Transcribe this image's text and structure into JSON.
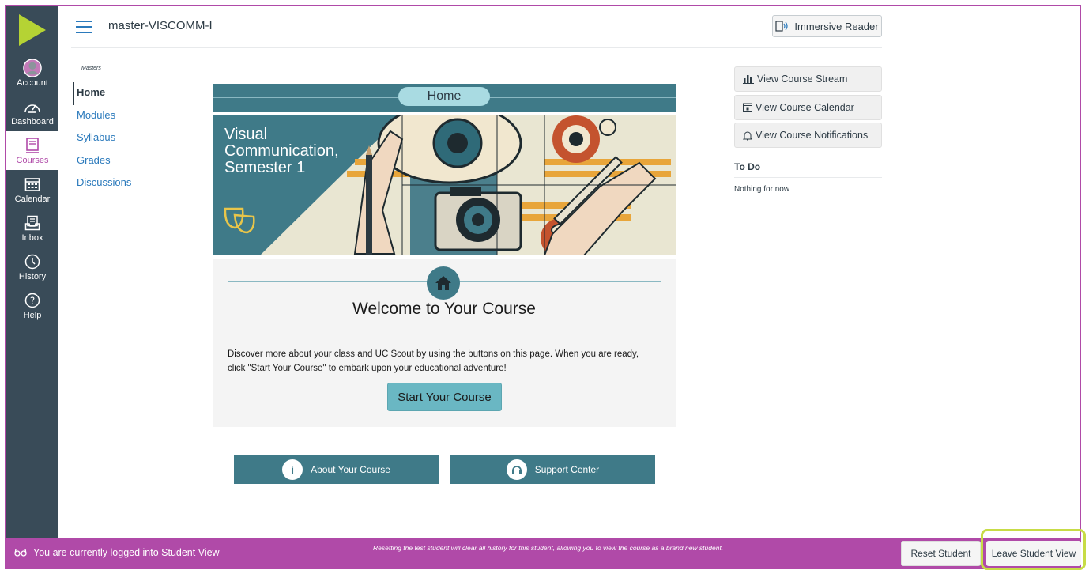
{
  "colors": {
    "nav_bg": "#394b58",
    "accent": "#b04aa8",
    "teal": "#3f7a88",
    "link": "#2b7abc",
    "highlight": "#c7dc46"
  },
  "global_nav": {
    "logo": "canvas-play-icon",
    "items": [
      {
        "label": "Account",
        "icon": "avatar-icon"
      },
      {
        "label": "Dashboard",
        "icon": "dashboard-icon"
      },
      {
        "label": "Courses",
        "icon": "courses-icon",
        "active": true
      },
      {
        "label": "Calendar",
        "icon": "calendar-icon"
      },
      {
        "label": "Inbox",
        "icon": "inbox-icon"
      },
      {
        "label": "History",
        "icon": "clock-icon"
      },
      {
        "label": "Help",
        "icon": "help-icon"
      }
    ]
  },
  "header": {
    "course_title": "master-VISCOMM-I",
    "immersive_reader": "Immersive Reader"
  },
  "course_nav": {
    "tag": "Masters",
    "items": [
      {
        "label": "Home",
        "active": true
      },
      {
        "label": "Modules"
      },
      {
        "label": "Syllabus"
      },
      {
        "label": "Grades"
      },
      {
        "label": "Discussions"
      }
    ]
  },
  "main": {
    "home_label": "Home",
    "banner": {
      "line1": "Visual",
      "line2": "Communication,",
      "line3": "Semester 1"
    },
    "welcome_title": "Welcome to Your Course",
    "welcome_desc": "Discover more about your class and UC Scout by using the buttons on this page. When you are ready, click \"Start Your Course\" to embark upon your educational adventure!",
    "start_button": "Start Your Course",
    "about_button": "About Your Course",
    "support_button": "Support Center"
  },
  "sidebar": {
    "stream": "View Course Stream",
    "calendar": "View Course Calendar",
    "notifications": "View Course Notifications",
    "todo_title": "To Do",
    "todo_empty": "Nothing for now"
  },
  "student_view": {
    "label": "You are currently logged into Student View",
    "note": "Resetting the test student will clear all history for this student, allowing you to view the course as a brand new student.",
    "reset": "Reset Student",
    "leave": "Leave Student View"
  }
}
